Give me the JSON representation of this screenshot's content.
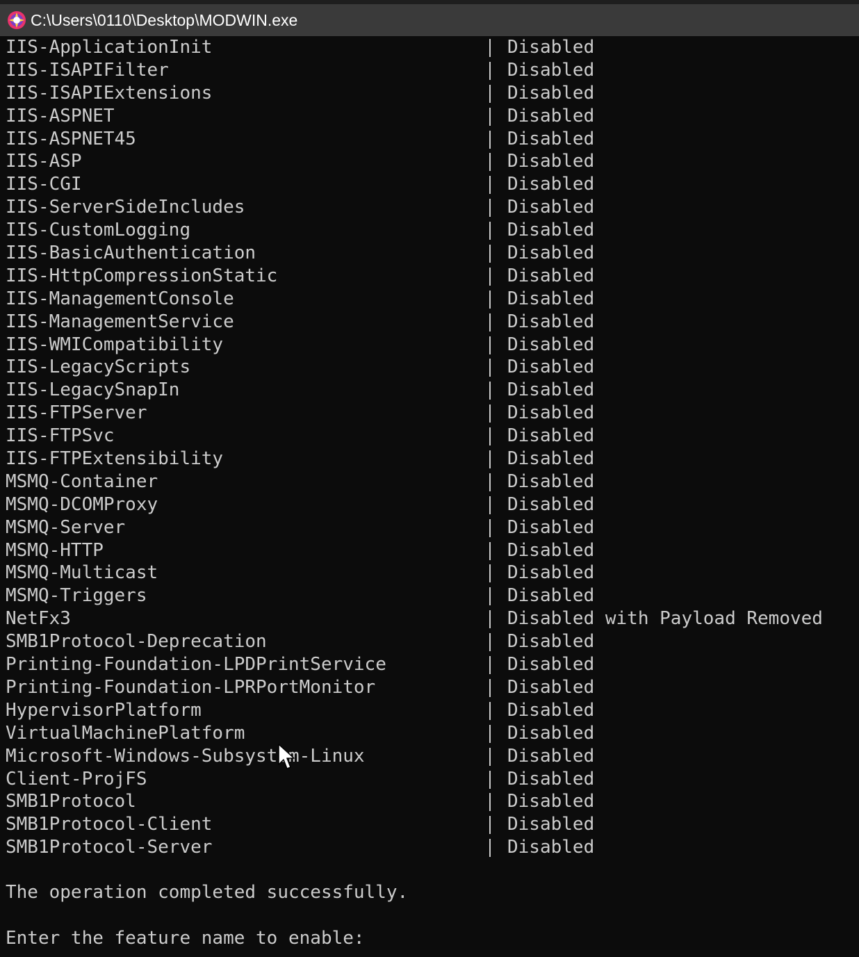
{
  "window": {
    "title": "C:\\Users\\0110\\Desktop\\MODWIN.exe",
    "icon": "app-icon"
  },
  "features": [
    {
      "name": "IIS-ApplicationInit",
      "state": "Disabled"
    },
    {
      "name": "IIS-ISAPIFilter",
      "state": "Disabled"
    },
    {
      "name": "IIS-ISAPIExtensions",
      "state": "Disabled"
    },
    {
      "name": "IIS-ASPNET",
      "state": "Disabled"
    },
    {
      "name": "IIS-ASPNET45",
      "state": "Disabled"
    },
    {
      "name": "IIS-ASP",
      "state": "Disabled"
    },
    {
      "name": "IIS-CGI",
      "state": "Disabled"
    },
    {
      "name": "IIS-ServerSideIncludes",
      "state": "Disabled"
    },
    {
      "name": "IIS-CustomLogging",
      "state": "Disabled"
    },
    {
      "name": "IIS-BasicAuthentication",
      "state": "Disabled"
    },
    {
      "name": "IIS-HttpCompressionStatic",
      "state": "Disabled"
    },
    {
      "name": "IIS-ManagementConsole",
      "state": "Disabled"
    },
    {
      "name": "IIS-ManagementService",
      "state": "Disabled"
    },
    {
      "name": "IIS-WMICompatibility",
      "state": "Disabled"
    },
    {
      "name": "IIS-LegacyScripts",
      "state": "Disabled"
    },
    {
      "name": "IIS-LegacySnapIn",
      "state": "Disabled"
    },
    {
      "name": "IIS-FTPServer",
      "state": "Disabled"
    },
    {
      "name": "IIS-FTPSvc",
      "state": "Disabled"
    },
    {
      "name": "IIS-FTPExtensibility",
      "state": "Disabled"
    },
    {
      "name": "MSMQ-Container",
      "state": "Disabled"
    },
    {
      "name": "MSMQ-DCOMProxy",
      "state": "Disabled"
    },
    {
      "name": "MSMQ-Server",
      "state": "Disabled"
    },
    {
      "name": "MSMQ-HTTP",
      "state": "Disabled"
    },
    {
      "name": "MSMQ-Multicast",
      "state": "Disabled"
    },
    {
      "name": "MSMQ-Triggers",
      "state": "Disabled"
    },
    {
      "name": "NetFx3",
      "state": "Disabled with Payload Removed"
    },
    {
      "name": "SMB1Protocol-Deprecation",
      "state": "Disabled"
    },
    {
      "name": "Printing-Foundation-LPDPrintService",
      "state": "Disabled"
    },
    {
      "name": "Printing-Foundation-LPRPortMonitor",
      "state": "Disabled"
    },
    {
      "name": "HypervisorPlatform",
      "state": "Disabled"
    },
    {
      "name": "VirtualMachinePlatform",
      "state": "Disabled"
    },
    {
      "name": "Microsoft-Windows-Subsystem-Linux",
      "state": "Disabled"
    },
    {
      "name": "Client-ProjFS",
      "state": "Disabled"
    },
    {
      "name": "SMB1Protocol",
      "state": "Disabled"
    },
    {
      "name": "SMB1Protocol-Client",
      "state": "Disabled"
    },
    {
      "name": "SMB1Protocol-Server",
      "state": "Disabled"
    }
  ],
  "messages": {
    "result": "The operation completed successfully.",
    "prompt": "Enter the feature name to enable:"
  },
  "colors": {
    "background": "#0c0c0c",
    "text": "#cccccc",
    "titlebar": "#3a3a3a"
  }
}
